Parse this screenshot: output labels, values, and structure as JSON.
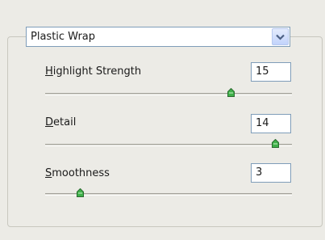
{
  "filter": {
    "selected": "Plastic Wrap",
    "dropdown_icon": "chevron-down-icon"
  },
  "params": [
    {
      "label_mnemonic": "H",
      "label_rest": "ighlight Strength",
      "value": "15",
      "min": 0,
      "max": 20,
      "level": 0.75
    },
    {
      "label_mnemonic": "D",
      "label_rest": "etail",
      "value": "14",
      "min": 1,
      "max": 15,
      "level": 0.93
    },
    {
      "label_mnemonic": "S",
      "label_rest": "moothness",
      "value": "3",
      "min": 1,
      "max": 15,
      "level": 0.14
    }
  ],
  "colors": {
    "thumb_fill": "#3fb04a",
    "thumb_border": "#2a6b2f",
    "input_border": "#7f9db9",
    "panel_bg": "#ecebe6"
  }
}
